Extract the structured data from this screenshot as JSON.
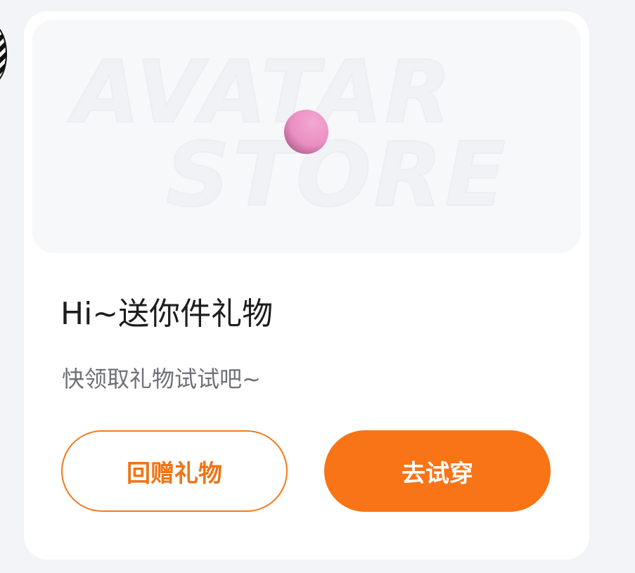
{
  "banner": {
    "watermark_line1": "AVATAR",
    "watermark_line2": "STORE"
  },
  "gift": {
    "title": "Hi~送你件礼物",
    "subtitle": "快领取礼物试试吧~"
  },
  "actions": {
    "return_gift_label": "回赠礼物",
    "try_on_label": "去试穿"
  },
  "colors": {
    "accent": "#F87416",
    "gift_ball": "#EA8FC2",
    "title_text": "#1D1D1F",
    "subtitle_text": "#6F7078"
  }
}
